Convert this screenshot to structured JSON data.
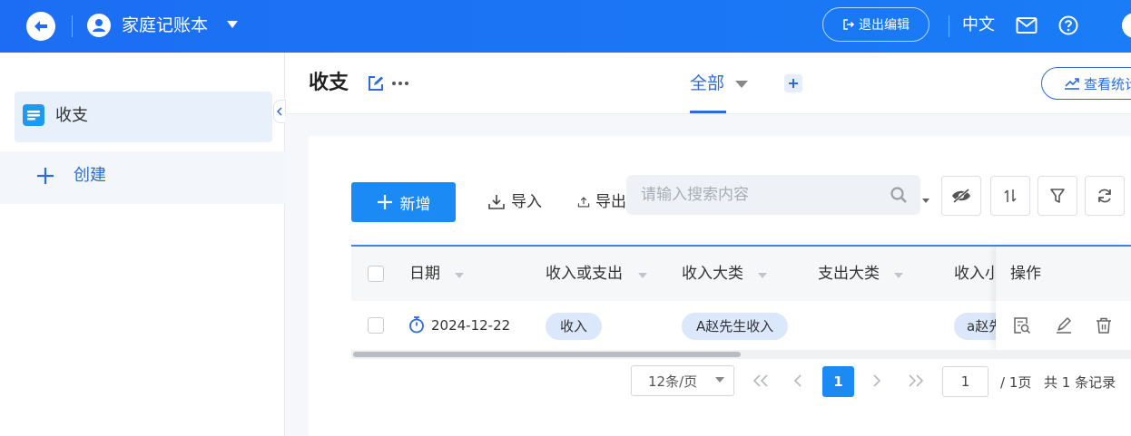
{
  "topbar": {
    "app_title": "家庭记账本",
    "exit_edit_label": "退出编辑",
    "language": "中文"
  },
  "sidebar": {
    "items": [
      {
        "label": "收支"
      },
      {
        "label": "创建"
      }
    ]
  },
  "main": {
    "title": "收支",
    "tabs": [
      {
        "label": "全部"
      }
    ],
    "stats_button": "查看统计"
  },
  "toolbar": {
    "add_label": "新增",
    "import_label": "导入",
    "export_label": "导出",
    "search_placeholder": "请输入搜索内容"
  },
  "table": {
    "columns": [
      "日期",
      "收入或支出",
      "收入大类",
      "支出大类",
      "收入小类",
      "操作"
    ],
    "rows": [
      {
        "date": "2024-12-22",
        "type": "收入",
        "income_category": "A赵先生收入",
        "expense_category": "",
        "income_subcategory": "a赵先生"
      }
    ]
  },
  "pagination": {
    "page_size": "12条/页",
    "current_page": "1",
    "jump_value": "1",
    "total_pages": "/ 1页",
    "record_count": "共 1 条记录"
  },
  "colors": {
    "primary": "#1c8af4",
    "topbar": "#1a73f5",
    "accent_text": "#2b6cd8",
    "tag_bg": "#dbe7fb"
  }
}
